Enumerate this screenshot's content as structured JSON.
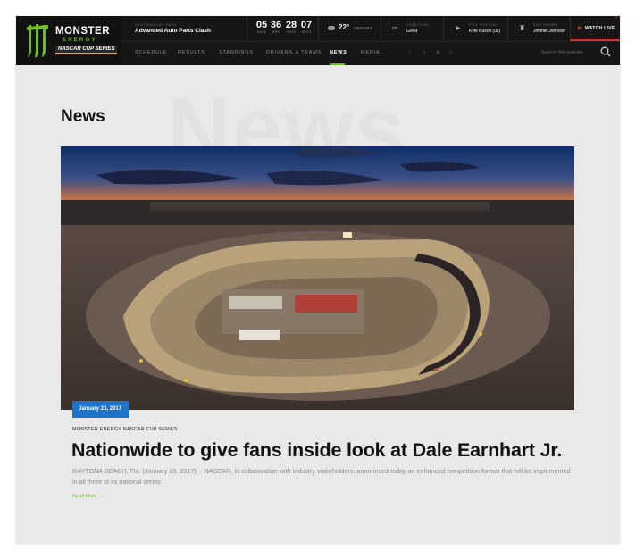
{
  "brand": {
    "name_line1": "MONSTER",
    "name_line2": "ENERGY",
    "name_line3": "NASCAR CUP SERIES",
    "accent_color": "#6fbf22",
    "badge_color": "#1d74c8",
    "live_color": "#e02a2a"
  },
  "topbar": {
    "next_race_label": "NEXT NASCAR RACE",
    "next_race_name": "Advanced Auto Parts Clash",
    "countdown": [
      {
        "value": "05",
        "unit": "DAYS"
      },
      {
        "value": "36",
        "unit": "HRS"
      },
      {
        "value": "28",
        "unit": "MINS"
      },
      {
        "value": "07",
        "unit": "SECS"
      }
    ],
    "weather": {
      "temp": "22°",
      "location": "INDIANA",
      "icon": "cloud-icon"
    },
    "conditions": {
      "label": "CONDITIONS",
      "value": "Good",
      "icon": "glasses-icon"
    },
    "pole_position": {
      "label": "POLE POSITION",
      "value": "Kyle Busch (us)",
      "icon": "car-icon"
    },
    "past_winner": {
      "label": "PAST WINNER",
      "value": "Jimmie Johnson",
      "icon": "trophy-icon"
    },
    "watch_live": "WATCH LIVE"
  },
  "nav": {
    "items": [
      "SCHEDULE",
      "RESULTS",
      "STANDINGS",
      "DRIVERS & TEAMS",
      "NEWS",
      "MEDIA"
    ],
    "active": "NEWS",
    "social_icons": [
      "facebook-icon",
      "twitter-icon",
      "youtube-icon",
      "instagram-icon"
    ],
    "search_placeholder": "Search the website"
  },
  "page": {
    "heading": "News",
    "background_word": "News"
  },
  "article": {
    "date": "January 23, 2017",
    "category": "MONSTER ENERGY NASCAR CUP SERIES",
    "title": "Nationwide to give fans inside look at Dale Earnhart Jr.",
    "summary": "DAYTONA BEACH, Fla. (January 23, 2017) -- NASCAR, in collaboration with industry stakeholders, announced today an enhanced competition format that will be implemented in all three of its national series",
    "read_more": "Read More →"
  }
}
